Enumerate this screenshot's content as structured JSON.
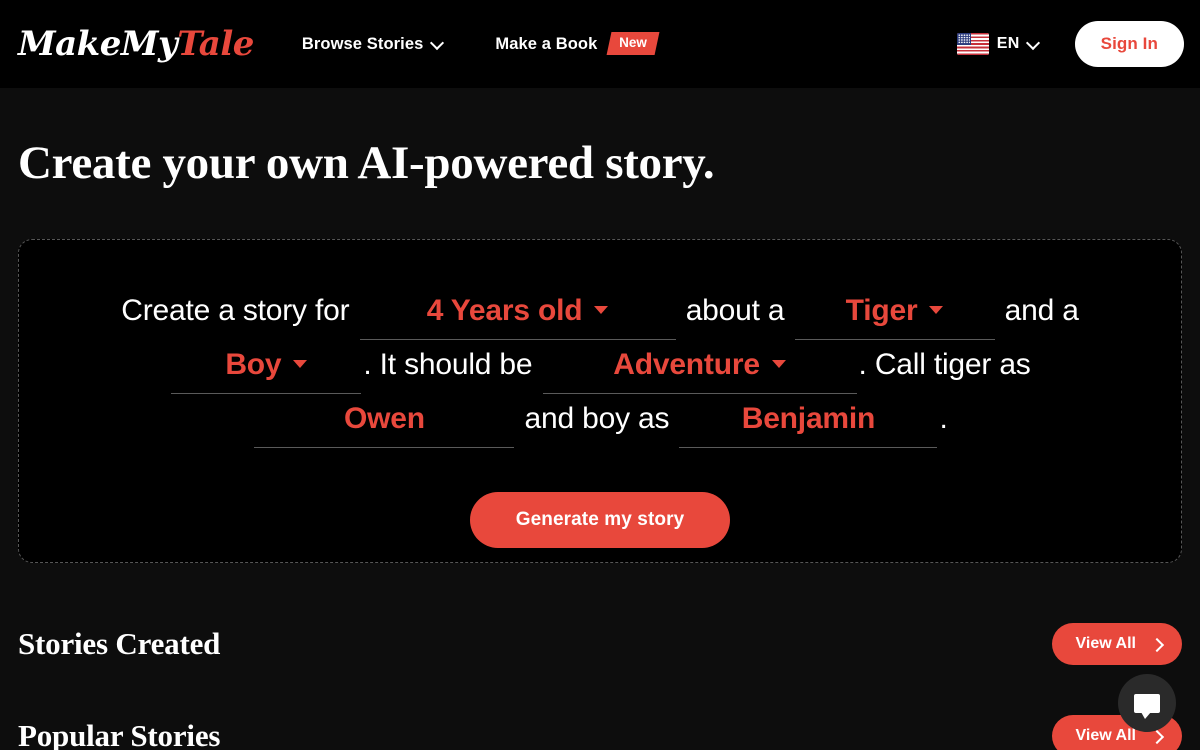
{
  "header": {
    "logo": {
      "part1": "MakeMy",
      "part2": "Tale"
    },
    "nav": [
      {
        "label": "Browse Stories",
        "icon": "chevron-down-icon",
        "badge": null
      },
      {
        "label": "Make a Book",
        "icon": null,
        "badge": "New"
      }
    ],
    "language": {
      "flag": "us-flag-icon",
      "label": "EN",
      "icon": "chevron-down-icon"
    },
    "sign_in_label": "Sign In"
  },
  "main": {
    "page_title": "Create your own AI-powered story.",
    "prompt": {
      "t1": "Create a story for",
      "age": "4 Years old",
      "t2": "about a",
      "animal": "Tiger",
      "t3": "and a",
      "gender": "Boy",
      "p1": ".",
      "t4": "It should be",
      "genre": "Adventure",
      "p2": ".",
      "t5": "Call tiger as",
      "animal_name": "Owen",
      "t6": "and boy as",
      "boy_name": "Benjamin",
      "p3": "."
    },
    "generate_label": "Generate my story",
    "sections": [
      {
        "title": "Stories Created",
        "action": "View All",
        "action_icon": "chevron-right-icon"
      },
      {
        "title": "Popular Stories",
        "action": "View All",
        "action_icon": "chevron-right-icon"
      }
    ]
  },
  "chat": {
    "icon": "chat-bubble-icon"
  },
  "colors": {
    "accent": "#e8483c",
    "background": "#0d0d0d",
    "header_background": "#000000",
    "text": "#ffffff",
    "border_dashed": "#565656"
  }
}
